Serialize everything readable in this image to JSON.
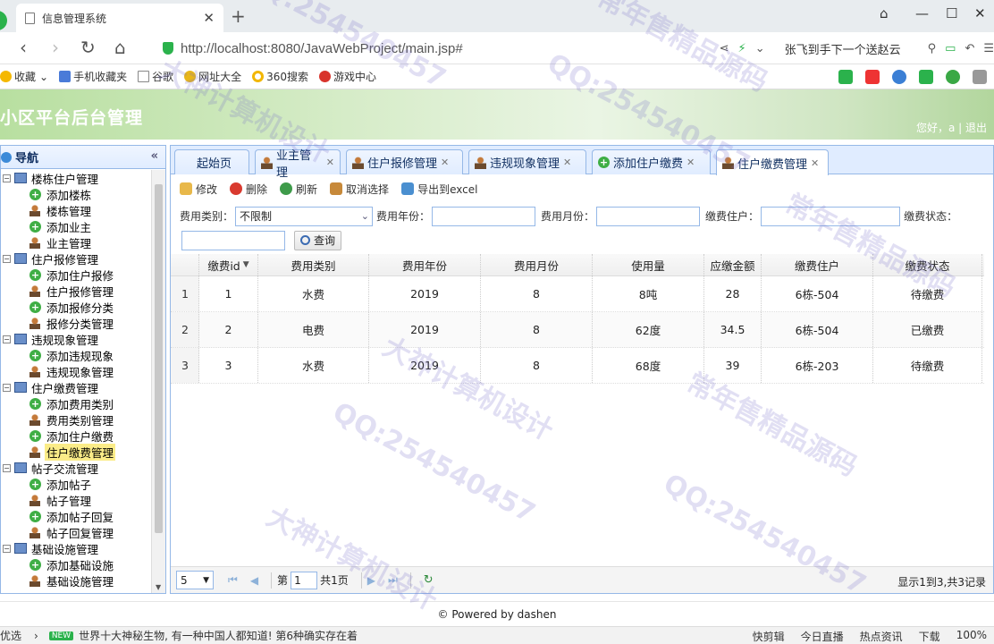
{
  "browser": {
    "tab_title": "信息管理系统",
    "tab_close": "✕",
    "new_tab": "+",
    "url": "http://localhost:8080/JavaWebProject/main.jsp#",
    "search_hint": "张飞到手下一个送赵云",
    "bookmarks": [
      "收藏",
      "手机收藏夹",
      "谷歌",
      "网址大全",
      "360搜索",
      "游戏中心"
    ]
  },
  "header": {
    "title": "小区平台后台管理",
    "greeting": "您好，a | 退出"
  },
  "sidebar": {
    "title": "导航",
    "collapse": "«",
    "groups": [
      {
        "label": "楼栋住户管理",
        "items": [
          {
            "label": "添加楼栋",
            "icon": "plus"
          },
          {
            "label": "楼栋管理",
            "icon": "user"
          },
          {
            "label": "添加业主",
            "icon": "plus"
          },
          {
            "label": "业主管理",
            "icon": "user"
          }
        ]
      },
      {
        "label": "住户报修管理",
        "items": [
          {
            "label": "添加住户报修",
            "icon": "plus"
          },
          {
            "label": "住户报修管理",
            "icon": "user"
          },
          {
            "label": "添加报修分类",
            "icon": "plus"
          },
          {
            "label": "报修分类管理",
            "icon": "user"
          }
        ]
      },
      {
        "label": "违规现象管理",
        "items": [
          {
            "label": "添加违规现象",
            "icon": "plus"
          },
          {
            "label": "违规现象管理",
            "icon": "user"
          }
        ]
      },
      {
        "label": "住户缴费管理",
        "items": [
          {
            "label": "添加费用类别",
            "icon": "plus"
          },
          {
            "label": "费用类别管理",
            "icon": "user"
          },
          {
            "label": "添加住户缴费",
            "icon": "plus"
          },
          {
            "label": "住户缴费管理",
            "icon": "user",
            "selected": true
          }
        ]
      },
      {
        "label": "帖子交流管理",
        "items": [
          {
            "label": "添加帖子",
            "icon": "plus"
          },
          {
            "label": "帖子管理",
            "icon": "user"
          },
          {
            "label": "添加帖子回复",
            "icon": "plus"
          },
          {
            "label": "帖子回复管理",
            "icon": "user"
          }
        ]
      },
      {
        "label": "基础设施管理",
        "items": [
          {
            "label": "添加基础设施",
            "icon": "plus"
          },
          {
            "label": "基础设施管理",
            "icon": "user"
          }
        ]
      }
    ]
  },
  "tabs": [
    {
      "label": "起始页",
      "icon": "none",
      "closable": false
    },
    {
      "label": "业主管理",
      "icon": "user",
      "closable": true
    },
    {
      "label": "住户报修管理",
      "icon": "user",
      "closable": true
    },
    {
      "label": "违规现象管理",
      "icon": "user",
      "closable": true
    },
    {
      "label": "添加住户缴费",
      "icon": "plus",
      "closable": true
    },
    {
      "label": "住户缴费管理",
      "icon": "user",
      "closable": true,
      "active": true
    }
  ],
  "toolbar": {
    "edit": "修改",
    "delete": "删除",
    "refresh": "刷新",
    "deselect": "取消选择",
    "export": "导出到excel"
  },
  "filters": {
    "fee_type_label": "费用类别：",
    "fee_type_value": "不限制",
    "year_label": "费用年份：",
    "month_label": "费用月份：",
    "household_label": "缴费住户：",
    "status_label": "缴费状态：",
    "query_button": "查询"
  },
  "grid": {
    "columns": [
      "缴费id",
      "费用类别",
      "费用年份",
      "费用月份",
      "使用量",
      "应缴金额",
      "缴费住户",
      "缴费状态"
    ],
    "rows": [
      [
        "1",
        "1",
        "水费",
        "2019",
        "8",
        "8吨",
        "28",
        "6栋-504",
        "待缴费"
      ],
      [
        "2",
        "2",
        "电费",
        "2019",
        "8",
        "62度",
        "34.5",
        "6栋-504",
        "已缴费"
      ],
      [
        "3",
        "3",
        "水费",
        "2019",
        "8",
        "68度",
        "39",
        "6栋-203",
        "待缴费"
      ]
    ]
  },
  "pager": {
    "page_size": "5",
    "page_prefix": "第",
    "page_value": "1",
    "page_total": "共1页",
    "info": "显示1到3,共3记录"
  },
  "footer": "© Powered by dashen",
  "statusbar": {
    "left": "优选",
    "badge": "NEW",
    "news": "世界十大神秘生物, 有一种中国人都知道! 第6种确实存在着",
    "items": [
      "快剪辑",
      "今日直播",
      "热点资讯",
      "下载",
      "100%"
    ]
  },
  "watermarks": [
    "QQ:254540457",
    "常年售精品源码",
    "大神计算机设计",
    "QQ:254540457",
    "常年售精品源码",
    "大神计算机设计",
    "QQ:254540457",
    "QQ:254540457",
    "常年售精品源码",
    "大神计算机设计"
  ]
}
